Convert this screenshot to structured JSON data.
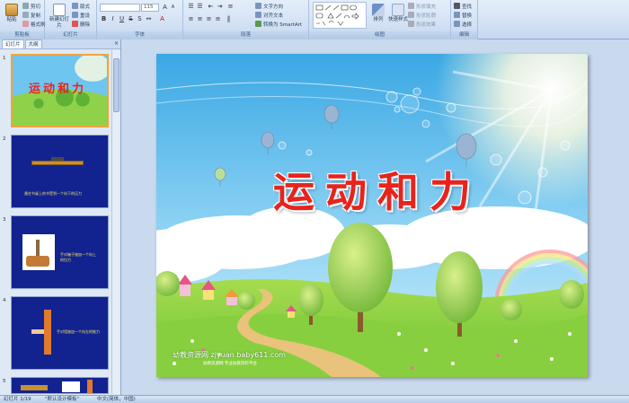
{
  "ribbon": {
    "clipboard": {
      "paste": "粘贴",
      "cut": "剪切",
      "copy": "复制",
      "format_painter": "格式刷",
      "group": "剪贴板"
    },
    "slides": {
      "new_slide": "新建幻灯片",
      "layout": "版式",
      "reset": "重设",
      "delete": "删除",
      "group": "幻灯片"
    },
    "font": {
      "font_name": "",
      "font_size": "115",
      "group": "字体"
    },
    "paragraph": {
      "text_direction": "文字方向",
      "align_text": "对齐文本",
      "convert_smartart": "转换为 SmartArt",
      "group": "段落"
    },
    "drawing": {
      "arrange": "排列",
      "quick_styles": "快速样式",
      "shape_fill": "形状填充",
      "shape_outline": "形状轮廓",
      "shape_effects": "形状效果",
      "group": "绘图"
    },
    "editing": {
      "find": "查找",
      "replace": "替换",
      "select": "选择",
      "group": "编辑"
    }
  },
  "panel": {
    "tabs": [
      "幻灯片",
      "大纲"
    ],
    "close": "×",
    "thumbs": [
      {
        "num": "1",
        "title": "运动和力"
      },
      {
        "num": "2",
        "caption": "悬在书桌上的书受到一个向下的压力"
      },
      {
        "num": "3",
        "caption": "手对箱子施加一个向上的拉力"
      },
      {
        "num": "4",
        "caption": "手对墙施加一个向左的推力"
      },
      {
        "num": "5"
      }
    ]
  },
  "slide": {
    "title": "运动和力",
    "watermark": "幼教资源网 zjyuan.baby611.com",
    "watermark_sub": "幼教资源网 专业幼教资料平台"
  },
  "status": {
    "slide_count": "幻灯片 1/19",
    "theme": "\"默认设计模板\"",
    "language": "中文(简体，中国)"
  },
  "colors": {
    "title_red": "#e8231d",
    "sky_top": "#3aa8e4",
    "sky_bottom": "#cfeefa",
    "grass": "#7ccd3a",
    "thumb_blue": "#12238f",
    "selection": "#f2a33a"
  }
}
